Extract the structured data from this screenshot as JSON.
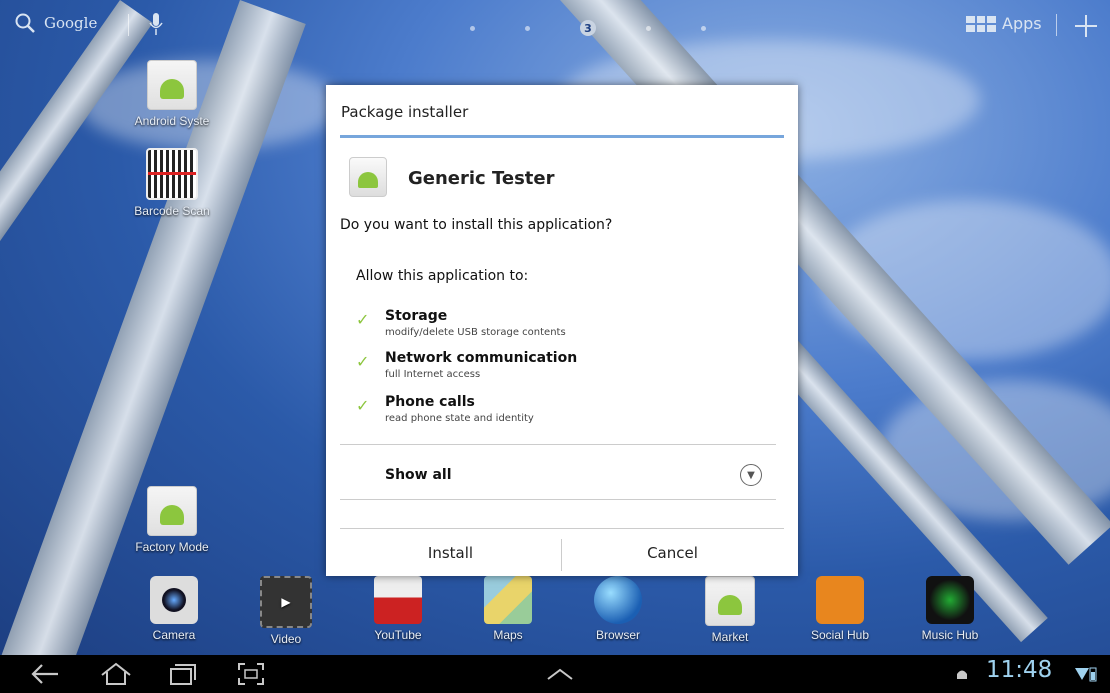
{
  "topbar": {
    "search_label": "Google",
    "page_indicator": "3",
    "apps_label": "Apps"
  },
  "desktop": {
    "icons": [
      {
        "label": "Android Syste"
      },
      {
        "label": "Barcode Scan"
      },
      {
        "label": "Factory Mode"
      }
    ]
  },
  "dock": {
    "items": [
      {
        "label": "Camera"
      },
      {
        "label": "Video"
      },
      {
        "label": "YouTube"
      },
      {
        "label": "Maps"
      },
      {
        "label": "Browser"
      },
      {
        "label": "Market"
      },
      {
        "label": "Social Hub"
      },
      {
        "label": "Music Hub"
      }
    ]
  },
  "dialog": {
    "title": "Package installer",
    "app_name": "Generic Tester",
    "question": "Do you want to install this application?",
    "allow_heading": "Allow this application to:",
    "permissions": [
      {
        "title": "Storage",
        "desc": "modify/delete USB storage contents"
      },
      {
        "title": "Network communication",
        "desc": "full Internet access"
      },
      {
        "title": "Phone calls",
        "desc": "read phone state and identity"
      }
    ],
    "show_all": "Show all",
    "install_label": "Install",
    "cancel_label": "Cancel"
  },
  "statusbar": {
    "time": "11:48"
  },
  "colors": {
    "accent": "#77a6dc",
    "check": "#8dc63f",
    "clock": "#9fd2ef"
  }
}
